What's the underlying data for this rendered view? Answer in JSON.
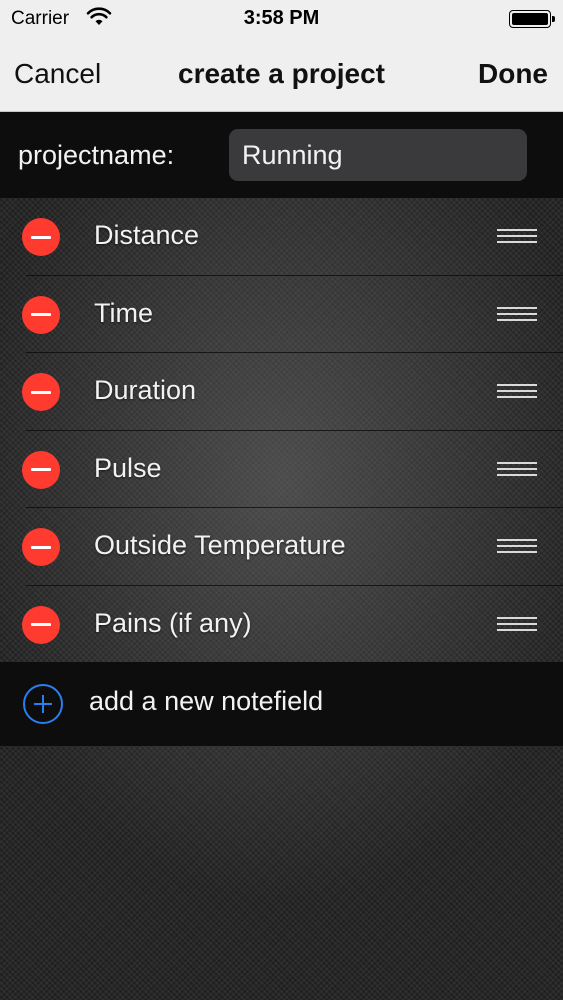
{
  "status_bar": {
    "carrier": "Carrier",
    "time": "3:58 PM"
  },
  "nav": {
    "cancel_label": "Cancel",
    "title": "create a project",
    "done_label": "Done"
  },
  "project": {
    "name_label": "projectname:",
    "name_value": "Running"
  },
  "fields": [
    {
      "label": "Distance"
    },
    {
      "label": "Time"
    },
    {
      "label": "Duration"
    },
    {
      "label": "Pulse"
    },
    {
      "label": "Outside Temperature"
    },
    {
      "label": "Pains (if any)"
    }
  ],
  "add_field": {
    "label": "add a new notefield"
  },
  "colors": {
    "delete": "#ff3b30",
    "add_accent": "#2a7ef0",
    "nav_background": "#efeff0"
  },
  "icons": {
    "delete": "minus-circle-icon",
    "reorder": "reorder-grip-icon",
    "add": "plus-circle-icon",
    "wifi": "wifi-icon",
    "battery": "battery-icon"
  }
}
